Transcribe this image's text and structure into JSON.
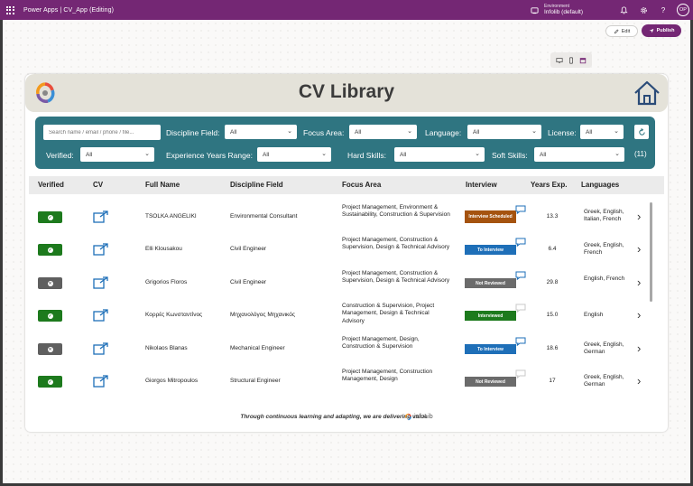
{
  "topbar": {
    "title": "Power Apps  |  CV_App (Editing)",
    "env_label": "Environment",
    "env_name": "Infolib (default)",
    "avatar": "OP"
  },
  "studio": {
    "edit_label": "Edit",
    "publish_label": "Publish"
  },
  "app": {
    "title": "CV Library",
    "footer": "Through continuous learning and adapting, we are delivering value",
    "footer_logo": "infoLib"
  },
  "filters": {
    "search_placeholder": "Search name / email / phone / file...",
    "discipline_label": "Discipline Field:",
    "discipline_value": "All",
    "focus_label": "Focus Area:",
    "focus_value": "All",
    "language_label": "Language:",
    "language_value": "All",
    "license_label": "License:",
    "license_value": "All",
    "verified_label": "Verified:",
    "verified_value": "All",
    "experience_label": "Experience Years Range:",
    "experience_value": "All",
    "hard_label": "Hard Skills:",
    "hard_value": "All",
    "soft_label": "Soft Skills:",
    "soft_value": "All",
    "count": "(11)"
  },
  "table": {
    "headers": [
      "Verified",
      "CV",
      "Full Name",
      "Discipline Field",
      "Focus Area",
      "Interview",
      "Years Exp.",
      "Languages"
    ],
    "rows": [
      {
        "verified": true,
        "name": "TSOLKA ANGELIKI",
        "discipline": "Environmental Consultant",
        "focus": "Project Management, Environment & Sustainability, Construction & Supervision",
        "interview": "Interview Scheduled",
        "interview_color": "#a5530f",
        "comment_filled": true,
        "years": "13.3",
        "languages": "Greek, English, Italian, French"
      },
      {
        "verified": true,
        "name": "Elli Klousakou",
        "discipline": "Civil Engineer",
        "focus": "Project Management, Construction & Supervision, Design & Technical Advisory",
        "interview": "To Interview",
        "interview_color": "#1e6fb8",
        "comment_filled": true,
        "years": "6.4",
        "languages": "Greek, English, French"
      },
      {
        "verified": false,
        "name": "Grigorios Floros",
        "discipline": "Civil Engineer",
        "focus": "Project Management, Construction & Supervision, Design & Technical Advisory",
        "interview": "Not Reviewed",
        "interview_color": "#6b6b6b",
        "comment_filled": true,
        "years": "29.8",
        "languages": "English, French"
      },
      {
        "verified": true,
        "name": "Κορρές Κωνσταντίνος",
        "discipline": "Μηχανολόγος Μηχανικός",
        "focus": "Construction & Supervision, Project Management, Design & Technical Advisory",
        "interview": "Interviewed",
        "interview_color": "#1d7a1d",
        "comment_filled": false,
        "years": "15.0",
        "languages": "English"
      },
      {
        "verified": false,
        "name": "Nikolaos Blanas",
        "discipline": "Mechanical Engineer",
        "focus": "Project Management, Design, Construction & Supervision",
        "interview": "To Interview",
        "interview_color": "#1e6fb8",
        "comment_filled": true,
        "years": "18.6",
        "languages": "Greek, English, German"
      },
      {
        "verified": true,
        "name": "Giorgos Mitropoulos",
        "discipline": "Structural Engineer",
        "focus": "Project Management, Construction Management, Design",
        "interview": "Not Reviewed",
        "interview_color": "#6b6b6b",
        "comment_filled": false,
        "years": "17",
        "languages": "Greek, English, German"
      }
    ]
  },
  "colors": {
    "brand": "#742774",
    "filter_panel": "#2f7581",
    "verified_true": "#1d7a1d",
    "verified_false": "#5f5f5f",
    "link_icon": "#1e6fb8"
  }
}
